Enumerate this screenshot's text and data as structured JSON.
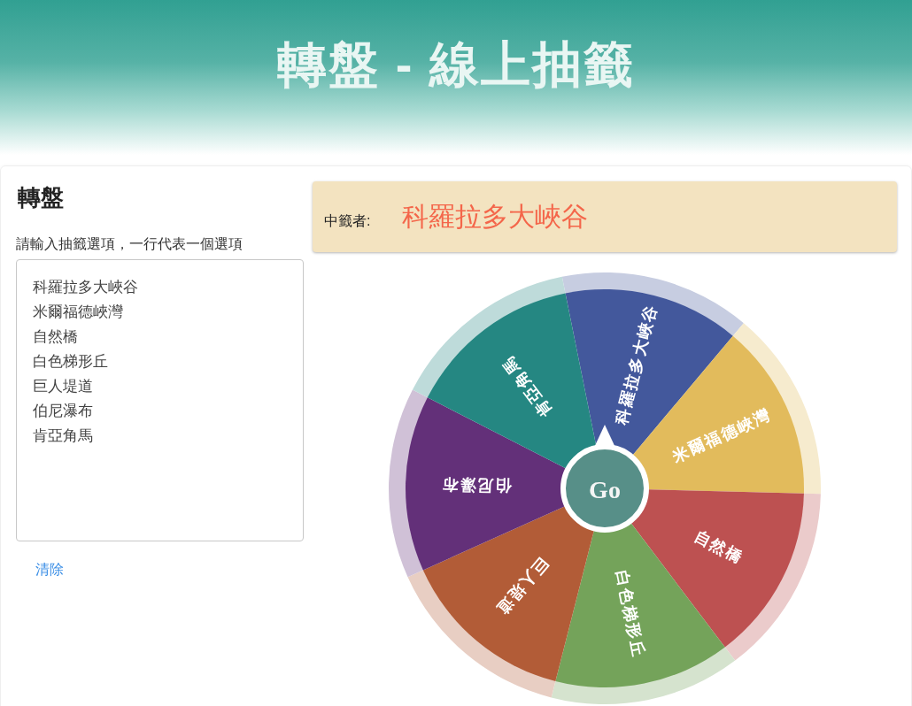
{
  "header": {
    "title": "轉盤 - 線上抽籤"
  },
  "sidebar": {
    "heading": "轉盤",
    "input_label": "請輸入抽籤選項，一行代表一個選項",
    "options_field": {
      "value": [
        "科羅拉多大峽谷",
        "米爾福德峽灣",
        "自然橋",
        "白色梯形丘",
        "巨人堤道",
        "伯尼瀑布",
        "肯亞角馬"
      ]
    },
    "clear_link": "清除"
  },
  "result": {
    "label": "中籤者:",
    "winner": "科羅拉多大峽谷"
  },
  "wheel": {
    "segments": [
      {
        "label": "科羅拉多大峽谷",
        "color": "#43589c"
      },
      {
        "label": "米爾福德峽灣",
        "color": "#e2bb5c"
      },
      {
        "label": "自然橋",
        "color": "#bd5151"
      },
      {
        "label": "白色梯形丘",
        "color": "#74a35a"
      },
      {
        "label": "巨人堤道",
        "color": "#b25c37"
      },
      {
        "label": "伯尼瀑布",
        "color": "#633079"
      },
      {
        "label": "肯亞角馬",
        "color": "#258782"
      }
    ],
    "go_button": "Go"
  }
}
